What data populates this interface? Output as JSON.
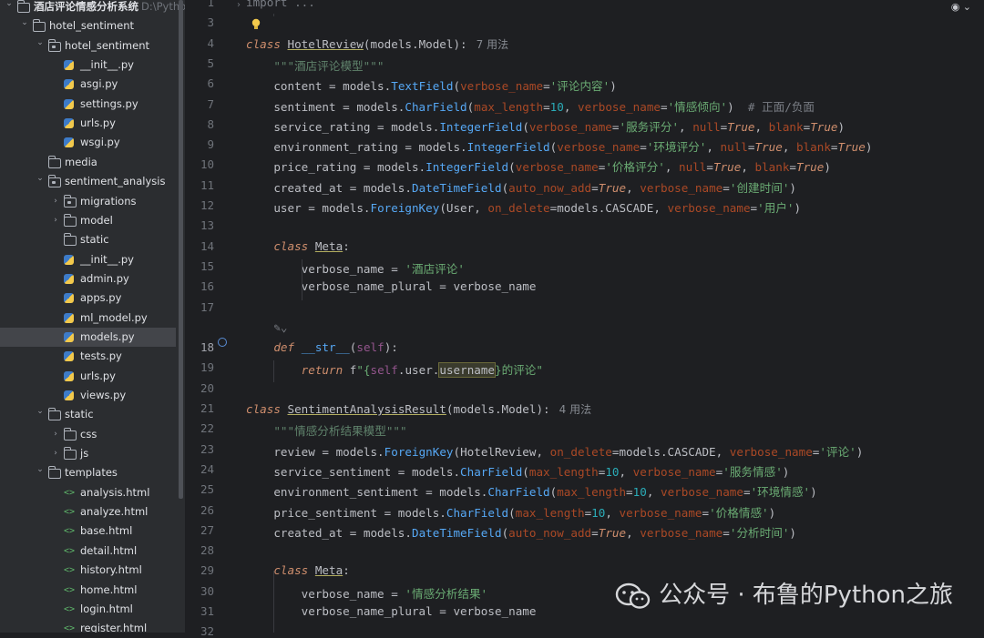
{
  "tree": {
    "rows": [
      {
        "label": "酒店评论情感分析系统",
        "suffix": "D:\\PythonP",
        "icon": "folder",
        "depth": 0,
        "chevron": "down",
        "bold": true
      },
      {
        "label": "hotel_sentiment",
        "icon": "folder",
        "depth": 1,
        "chevron": "down"
      },
      {
        "label": "hotel_sentiment",
        "icon": "package",
        "depth": 2,
        "chevron": "down"
      },
      {
        "label": "__init__.py",
        "icon": "python",
        "depth": 3
      },
      {
        "label": "asgi.py",
        "icon": "python",
        "depth": 3
      },
      {
        "label": "settings.py",
        "icon": "python",
        "depth": 3
      },
      {
        "label": "urls.py",
        "icon": "python",
        "depth": 3
      },
      {
        "label": "wsgi.py",
        "icon": "python",
        "depth": 3
      },
      {
        "label": "media",
        "icon": "folder",
        "depth": 2
      },
      {
        "label": "sentiment_analysis",
        "icon": "package",
        "depth": 2,
        "chevron": "down"
      },
      {
        "label": "migrations",
        "icon": "package",
        "depth": 3,
        "chevron": "right"
      },
      {
        "label": "model",
        "icon": "folder",
        "depth": 3,
        "chevron": "right"
      },
      {
        "label": "static",
        "icon": "folder",
        "depth": 3
      },
      {
        "label": "__init__.py",
        "icon": "python",
        "depth": 3
      },
      {
        "label": "admin.py",
        "icon": "python",
        "depth": 3
      },
      {
        "label": "apps.py",
        "icon": "python",
        "depth": 3
      },
      {
        "label": "ml_model.py",
        "icon": "python",
        "depth": 3
      },
      {
        "label": "models.py",
        "icon": "python",
        "depth": 3,
        "selected": true
      },
      {
        "label": "tests.py",
        "icon": "python",
        "depth": 3
      },
      {
        "label": "urls.py",
        "icon": "python",
        "depth": 3
      },
      {
        "label": "views.py",
        "icon": "python",
        "depth": 3
      },
      {
        "label": "static",
        "icon": "folder",
        "depth": 2,
        "chevron": "down"
      },
      {
        "label": "css",
        "icon": "folder",
        "depth": 3,
        "chevron": "right"
      },
      {
        "label": "js",
        "icon": "folder",
        "depth": 3,
        "chevron": "right"
      },
      {
        "label": "templates",
        "icon": "folder",
        "depth": 2,
        "chevron": "down"
      },
      {
        "label": "analysis.html",
        "icon": "html",
        "depth": 3
      },
      {
        "label": "analyze.html",
        "icon": "html",
        "depth": 3
      },
      {
        "label": "base.html",
        "icon": "html",
        "depth": 3
      },
      {
        "label": "detail.html",
        "icon": "html",
        "depth": 3
      },
      {
        "label": "history.html",
        "icon": "html",
        "depth": 3
      },
      {
        "label": "home.html",
        "icon": "html",
        "depth": 3
      },
      {
        "label": "login.html",
        "icon": "html",
        "depth": 3
      },
      {
        "label": "register.html",
        "icon": "html",
        "depth": 3
      }
    ]
  },
  "editor": {
    "current_line": 18,
    "lines": [
      {
        "n": "1",
        "segs": [
          [
            "cmt",
            "import ..."
          ]
        ]
      },
      {
        "n": "3",
        "segs": []
      },
      {
        "n": "4",
        "segs": [
          [
            "kw",
            "class "
          ],
          [
            "cls",
            "HotelReview"
          ],
          [
            "",
            "(models.Model):"
          ],
          [
            "hint",
            "7 用法"
          ]
        ]
      },
      {
        "n": "5",
        "segs": [
          [
            "",
            "    "
          ],
          [
            "doc",
            "\"\"\"酒店评论模型\"\"\""
          ]
        ]
      },
      {
        "n": "6",
        "segs": [
          [
            "",
            "    content = models."
          ],
          [
            "cyan",
            "TextField"
          ],
          [
            "",
            "("
          ],
          [
            "param",
            "verbose_name"
          ],
          [
            "",
            "="
          ],
          [
            "str",
            "'评论内容'"
          ],
          [
            "",
            ")"
          ]
        ]
      },
      {
        "n": "7",
        "segs": [
          [
            "",
            "    sentiment = models."
          ],
          [
            "cyan",
            "CharField"
          ],
          [
            "",
            "("
          ],
          [
            "param",
            "max_length"
          ],
          [
            "",
            "="
          ],
          [
            "num",
            "10"
          ],
          [
            "",
            ", "
          ],
          [
            "param",
            "verbose_name"
          ],
          [
            "",
            "="
          ],
          [
            "str",
            "'情感倾向'"
          ],
          [
            "",
            ")  "
          ],
          [
            "cmt",
            "# 正面/负面"
          ]
        ]
      },
      {
        "n": "8",
        "segs": [
          [
            "",
            "    service_rating = models."
          ],
          [
            "cyan",
            "IntegerField"
          ],
          [
            "",
            "("
          ],
          [
            "param",
            "verbose_name"
          ],
          [
            "",
            "="
          ],
          [
            "str",
            "'服务评分'"
          ],
          [
            "",
            ", "
          ],
          [
            "param",
            "null"
          ],
          [
            "",
            "="
          ],
          [
            "kw",
            "True"
          ],
          [
            "",
            ", "
          ],
          [
            "param",
            "blank"
          ],
          [
            "",
            "="
          ],
          [
            "kw",
            "True"
          ],
          [
            "",
            ")"
          ]
        ]
      },
      {
        "n": "9",
        "segs": [
          [
            "",
            "    environment_rating = models."
          ],
          [
            "cyan",
            "IntegerField"
          ],
          [
            "",
            "("
          ],
          [
            "param",
            "verbose_name"
          ],
          [
            "",
            "="
          ],
          [
            "str",
            "'环境评分'"
          ],
          [
            "",
            ", "
          ],
          [
            "param",
            "null"
          ],
          [
            "",
            "="
          ],
          [
            "kw",
            "True"
          ],
          [
            "",
            ", "
          ],
          [
            "param",
            "blank"
          ],
          [
            "",
            "="
          ],
          [
            "kw",
            "True"
          ],
          [
            "",
            ")"
          ]
        ]
      },
      {
        "n": "10",
        "segs": [
          [
            "",
            "    price_rating = models."
          ],
          [
            "cyan",
            "IntegerField"
          ],
          [
            "",
            "("
          ],
          [
            "param",
            "verbose_name"
          ],
          [
            "",
            "="
          ],
          [
            "str",
            "'价格评分'"
          ],
          [
            "",
            ", "
          ],
          [
            "param",
            "null"
          ],
          [
            "",
            "="
          ],
          [
            "kw",
            "True"
          ],
          [
            "",
            ", "
          ],
          [
            "param",
            "blank"
          ],
          [
            "",
            "="
          ],
          [
            "kw",
            "True"
          ],
          [
            "",
            ")"
          ]
        ]
      },
      {
        "n": "11",
        "segs": [
          [
            "",
            "    created_at = models."
          ],
          [
            "cyan",
            "DateTimeField"
          ],
          [
            "",
            "("
          ],
          [
            "param",
            "auto_now_add"
          ],
          [
            "",
            "="
          ],
          [
            "kw",
            "True"
          ],
          [
            "",
            ", "
          ],
          [
            "param",
            "verbose_name"
          ],
          [
            "",
            "="
          ],
          [
            "str",
            "'创建时间'"
          ],
          [
            "",
            ")"
          ]
        ]
      },
      {
        "n": "12",
        "segs": [
          [
            "",
            "    user = models."
          ],
          [
            "cyan",
            "ForeignKey"
          ],
          [
            "",
            "(User, "
          ],
          [
            "param",
            "on_delete"
          ],
          [
            "",
            "=models.CASCADE, "
          ],
          [
            "param",
            "verbose_name"
          ],
          [
            "",
            "="
          ],
          [
            "str",
            "'用户'"
          ],
          [
            "",
            ")"
          ]
        ]
      },
      {
        "n": "13",
        "segs": []
      },
      {
        "n": "14",
        "segs": [
          [
            "",
            "    "
          ],
          [
            "kw",
            "class "
          ],
          [
            "cls",
            "Meta"
          ],
          [
            "",
            ":"
          ]
        ]
      },
      {
        "n": "15",
        "segs": [
          [
            "",
            "        verbose_name = "
          ],
          [
            "str",
            "'酒店评论'"
          ]
        ]
      },
      {
        "n": "16",
        "segs": [
          [
            "",
            "        verbose_name_plural = verbose_name"
          ]
        ]
      },
      {
        "n": "17",
        "segs": []
      },
      {
        "n": "",
        "segs": [
          [
            "",
            "    "
          ],
          [
            "cmt",
            "✎⌄"
          ]
        ]
      },
      {
        "n": "18",
        "segs": [
          [
            "",
            "    "
          ],
          [
            "kw",
            "def "
          ],
          [
            "cyan",
            "__str__"
          ],
          [
            "",
            "("
          ],
          [
            "self",
            "self"
          ],
          [
            "",
            "):"
          ]
        ]
      },
      {
        "n": "19",
        "segs": [
          [
            "",
            "        "
          ],
          [
            "kw",
            "return "
          ],
          [
            "",
            "f"
          ],
          [
            "str",
            "\"{"
          ],
          [
            "self",
            "self"
          ],
          [
            "",
            ".user."
          ],
          [
            "hl",
            "username"
          ],
          [
            "str",
            "}的评论\""
          ]
        ]
      },
      {
        "n": "20",
        "segs": []
      },
      {
        "n": "21",
        "segs": [
          [
            "kw",
            "class "
          ],
          [
            "cls",
            "SentimentAnalysisResult"
          ],
          [
            "",
            "(models.Model):"
          ],
          [
            "hint",
            "4 用法"
          ]
        ]
      },
      {
        "n": "22",
        "segs": [
          [
            "",
            "    "
          ],
          [
            "doc",
            "\"\"\"情感分析结果模型\"\"\""
          ]
        ]
      },
      {
        "n": "23",
        "segs": [
          [
            "",
            "    review = models."
          ],
          [
            "cyan",
            "ForeignKey"
          ],
          [
            "",
            "(HotelReview, "
          ],
          [
            "param",
            "on_delete"
          ],
          [
            "",
            "=models.CASCADE, "
          ],
          [
            "param",
            "verbose_name"
          ],
          [
            "",
            "="
          ],
          [
            "str",
            "'评论'"
          ],
          [
            "",
            ")"
          ]
        ]
      },
      {
        "n": "24",
        "segs": [
          [
            "",
            "    service_sentiment = models."
          ],
          [
            "cyan",
            "CharField"
          ],
          [
            "",
            "("
          ],
          [
            "param",
            "max_length"
          ],
          [
            "",
            "="
          ],
          [
            "num",
            "10"
          ],
          [
            "",
            ", "
          ],
          [
            "param",
            "verbose_name"
          ],
          [
            "",
            "="
          ],
          [
            "str",
            "'服务情感'"
          ],
          [
            "",
            ")"
          ]
        ]
      },
      {
        "n": "25",
        "segs": [
          [
            "",
            "    environment_sentiment = models."
          ],
          [
            "cyan",
            "CharField"
          ],
          [
            "",
            "("
          ],
          [
            "param",
            "max_length"
          ],
          [
            "",
            "="
          ],
          [
            "num",
            "10"
          ],
          [
            "",
            ", "
          ],
          [
            "param",
            "verbose_name"
          ],
          [
            "",
            "="
          ],
          [
            "str",
            "'环境情感'"
          ],
          [
            "",
            ")"
          ]
        ]
      },
      {
        "n": "26",
        "segs": [
          [
            "",
            "    price_sentiment = models."
          ],
          [
            "cyan",
            "CharField"
          ],
          [
            "",
            "("
          ],
          [
            "param",
            "max_length"
          ],
          [
            "",
            "="
          ],
          [
            "num",
            "10"
          ],
          [
            "",
            ", "
          ],
          [
            "param",
            "verbose_name"
          ],
          [
            "",
            "="
          ],
          [
            "str",
            "'价格情感'"
          ],
          [
            "",
            ")"
          ]
        ]
      },
      {
        "n": "27",
        "segs": [
          [
            "",
            "    created_at = models."
          ],
          [
            "cyan",
            "DateTimeField"
          ],
          [
            "",
            "("
          ],
          [
            "param",
            "auto_now_add"
          ],
          [
            "",
            "="
          ],
          [
            "kw",
            "True"
          ],
          [
            "",
            ", "
          ],
          [
            "param",
            "verbose_name"
          ],
          [
            "",
            "="
          ],
          [
            "str",
            "'分析时间'"
          ],
          [
            "",
            ")"
          ]
        ]
      },
      {
        "n": "28",
        "segs": []
      },
      {
        "n": "29",
        "segs": [
          [
            "",
            "    "
          ],
          [
            "kw",
            "class "
          ],
          [
            "cls",
            "Meta"
          ],
          [
            "",
            ":"
          ]
        ]
      },
      {
        "n": "30",
        "segs": [
          [
            "",
            "        verbose_name = "
          ],
          [
            "str",
            "'情感分析结果'"
          ]
        ]
      },
      {
        "n": "31",
        "segs": [
          [
            "",
            "        verbose_name_plural = verbose_name"
          ]
        ]
      },
      {
        "n": "32",
        "segs": []
      }
    ]
  },
  "watermark": {
    "text": "公众号 · 布鲁的Python之旅"
  },
  "colors": {
    "bg": "#1e1f22",
    "tree_bg": "#2b2d30",
    "keyword": "#cf8e6d",
    "string": "#6aab73",
    "function": "#56a8f5",
    "number": "#2aacb8",
    "param": "#aa4926"
  }
}
